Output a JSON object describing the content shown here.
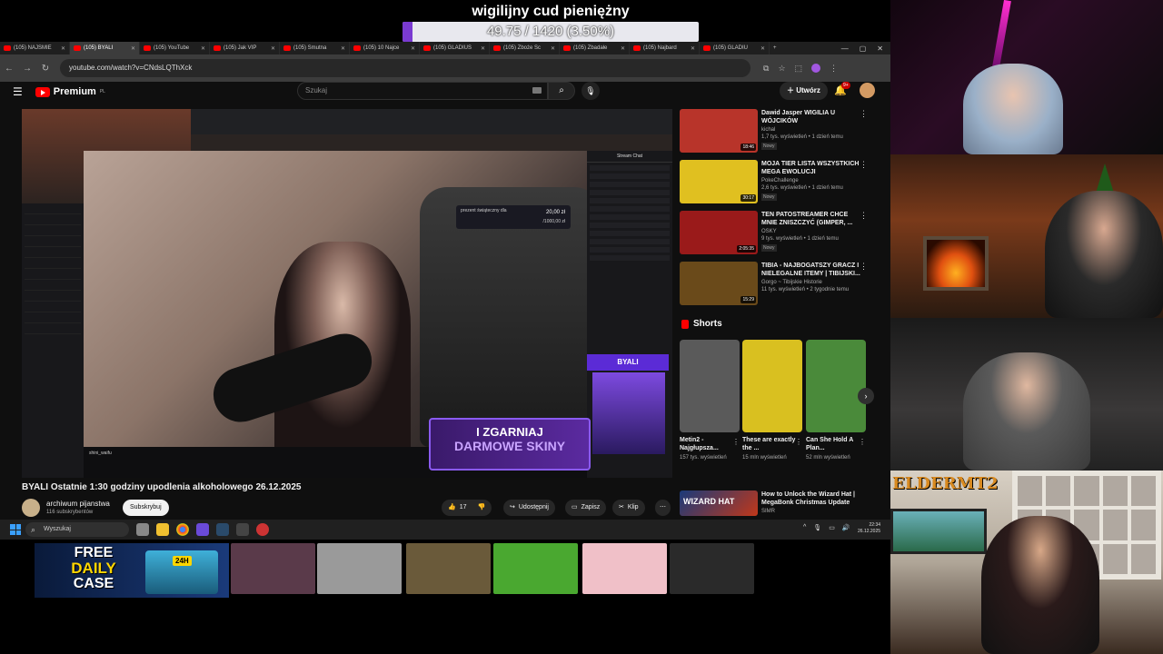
{
  "goal": {
    "title": "wigilijny cud pieniężny",
    "current": 49.75,
    "target": 1420,
    "progress_fraction": 0.035,
    "progress_text": "49.75 / 1420 (3.50%)",
    "fill_color": "#7a3ad1"
  },
  "browser": {
    "tabs": [
      {
        "label": "(105) NAJSMIE",
        "active": false
      },
      {
        "label": "(105) BYALI",
        "active": true
      },
      {
        "label": "(105) YouTube",
        "active": false
      },
      {
        "label": "(105) Jak VIP",
        "active": false
      },
      {
        "label": "(105) Smutna",
        "active": false
      },
      {
        "label": "(105) 10 Najce",
        "active": false
      },
      {
        "label": "(105) GLADIUS",
        "active": false
      },
      {
        "label": "(105) Zboże Sc",
        "active": false
      },
      {
        "label": "(105) Zbadałe",
        "active": false
      },
      {
        "label": "(105) Najbard",
        "active": false
      },
      {
        "label": "(105) GLADIU",
        "active": false
      }
    ],
    "new_tab": "+",
    "url": "youtube.com/watch?v=CNdsLQThXck"
  },
  "youtube": {
    "logo": "Premium",
    "logo_region": "PL",
    "search_placeholder": "Szukaj",
    "create_label": "Utwórz",
    "notif_count": "9+",
    "video": {
      "title": "BYALI Ostatnie 1:30 godziny upodlenia alkoholowego 26.12.2025",
      "channel": "archiwum pijanstwa",
      "subscribers": "116 subskrybentów",
      "subscribe_label": "Subskrybuj",
      "likes": "17",
      "share_label": "Udostępnij",
      "save_label": "Zapisz",
      "clip_label": "Klip",
      "inner": {
        "present_label": "prezent świąteczny dla",
        "present_amount": "20,00 zł",
        "present_sub": "/1000,00 zł",
        "chat_header": "Stream Chat",
        "byali_badge": "BYALI",
        "banner_line1": "I ZGARNIAJ",
        "banner_line2": "DARMOWE SKINY",
        "streamer_name": "shini_waifu"
      }
    },
    "recommendations": [
      {
        "title": "Dawid Jasper WIGILIA U WÓJCIKÓW",
        "channel": "kichal",
        "meta": "1,7 tys. wyświetleń • 1 dzień temu",
        "badge": "Nowy",
        "duration": "18:46",
        "thumb": "#b8342a"
      },
      {
        "title": "MOJA TIER LISTA WSZYSTKICH MEGA EWOLUCJI",
        "channel": "PokeChallenge",
        "meta": "2,6 tys. wyświetleń • 1 dzień temu",
        "badge": "Nowy",
        "duration": "30:17",
        "thumb": "#e0c020"
      },
      {
        "title": "TEN PATOSTREAMER CHCE MNIE ZNISZCZYĆ (GIMPER, ...",
        "channel": "OSKY",
        "meta": "9 tys. wyświetleń • 1 dzień temu",
        "badge": "Nowy",
        "duration": "2:05:35",
        "thumb": "#9a1a1a"
      },
      {
        "title": "TIBIA - NAJBOGATSZY GRACZ I NIELEGALNE ITEMY | TIBIJSKI...",
        "channel": "Gorgo ~ Tibijskie Historie",
        "meta": "11 tys. wyświetleń • 2 tygodnie temu",
        "badge": "",
        "duration": "15:29",
        "thumb": "#6a4a1a"
      }
    ],
    "shorts_label": "Shorts",
    "shorts": [
      {
        "title": "Metin2 - Najgłupsza...",
        "views": "157 tys. wyświetleń",
        "thumb": "#5a5a5a"
      },
      {
        "title": "These are exactly the ...",
        "views": "15 mln wyświetleń",
        "thumb": "#d9c020"
      },
      {
        "title": "Can She Hold A Plan...",
        "views": "52 mln wyświetleń",
        "thumb": "#4a8a3a"
      }
    ],
    "next_rec": {
      "title": "How to Unlock the Wizard Hat | MegaBonk Christmas Update",
      "channel": "SIMR",
      "thumb_text": "WIZARD HAT"
    }
  },
  "taskbar": {
    "search_label": "Wyszukaj",
    "time": "22:34",
    "date": "26.12.2025"
  },
  "promo": {
    "line1": "FREE",
    "line2": "DAILY",
    "line3": "CASE",
    "badge": "24H"
  },
  "emotes": [
    "#5a3a4a",
    "#9a9a9a",
    "#6a5a3a",
    "#4aa830",
    "#f0c0c8",
    "#2a2a2a"
  ],
  "overlay": {
    "elder_logo": "ELDERMT2"
  }
}
